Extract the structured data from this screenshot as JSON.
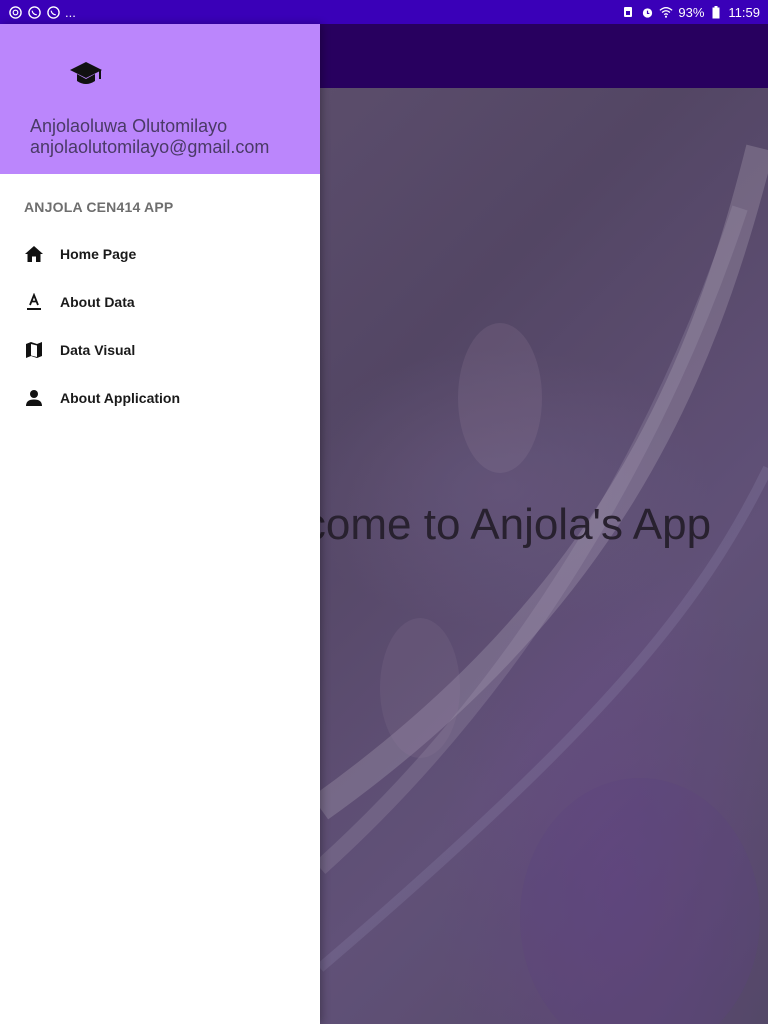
{
  "status_bar": {
    "left_icons": [
      "app-icon",
      "whatsapp-icon",
      "whatsapp-icon"
    ],
    "more": "...",
    "battery": "93%",
    "time": "11:59"
  },
  "background_app": {
    "welcome_text": "Welcome to Anjola's App"
  },
  "drawer": {
    "header": {
      "icon": "graduation-cap-icon",
      "name": "Anjolaoluwa Olutomilayo",
      "email": "anjolaolutomilayo@gmail.com",
      "color": "#bb86fc"
    },
    "section_title": "ANJOLA CEN414 APP",
    "items": [
      {
        "label": "Home Page",
        "icon": "home-icon"
      },
      {
        "label": "About Data",
        "icon": "text-format-icon"
      },
      {
        "label": "Data Visual",
        "icon": "map-icon"
      },
      {
        "label": "About Application",
        "icon": "person-icon"
      }
    ]
  },
  "colors": {
    "status_bar": "#3a00b8",
    "toolbar": "#2c0068",
    "drawer_header": "#bb86fc"
  }
}
